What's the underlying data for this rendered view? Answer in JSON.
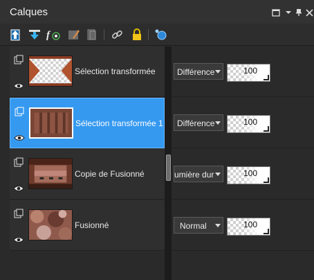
{
  "panel": {
    "title": "Calques"
  },
  "window_controls": [
    "restore-icon",
    "dropdown-icon",
    "pin-icon",
    "close-icon"
  ],
  "toolbar": {
    "tools": [
      "new-raster-layer-icon",
      "new-vector-layer-icon",
      "fx-layer-icon",
      "mask-brush-icon",
      "group-layers-icon",
      "link-icon",
      "lock-icon",
      "paint-globe-icon"
    ]
  },
  "layers": [
    {
      "name": "Sélection transformée",
      "selected": false,
      "blend_mode": "Différence",
      "opacity": "100"
    },
    {
      "name": "Sélection transformée 1",
      "selected": true,
      "blend_mode": "Différence",
      "opacity": "100"
    },
    {
      "name": "Copie de Fusionné",
      "selected": false,
      "blend_mode": "umière dur",
      "opacity": "100"
    },
    {
      "name": "Fusionné",
      "selected": false,
      "blend_mode": "Normal",
      "opacity": "100"
    }
  ],
  "colors": {
    "selected_row": "#3599f0",
    "panel_bg": "#2b2b2b",
    "accent_arrow": "#37b3f0"
  }
}
